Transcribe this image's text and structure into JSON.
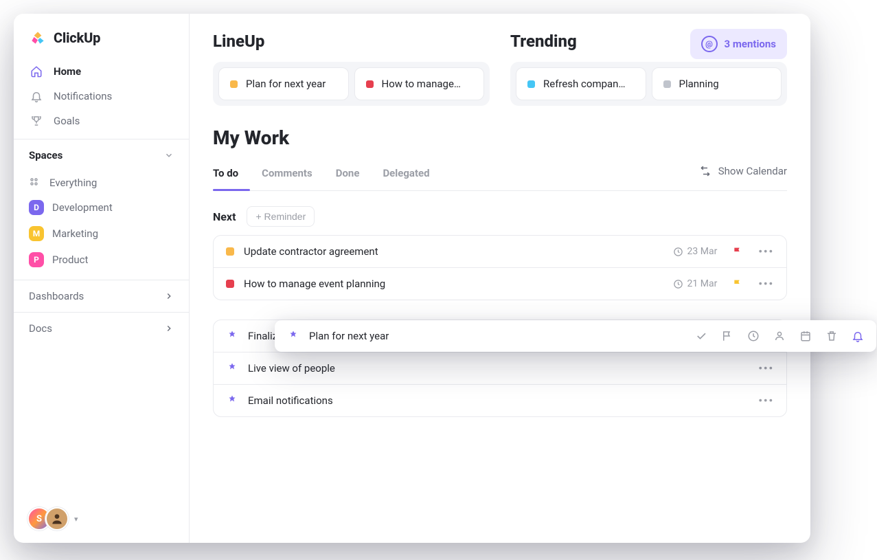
{
  "brand": {
    "name": "ClickUp"
  },
  "nav": {
    "home": {
      "label": "Home"
    },
    "notifications": {
      "label": "Notifications"
    },
    "goals": {
      "label": "Goals"
    }
  },
  "sidebar": {
    "spaces_header": "Spaces",
    "everything": "Everything",
    "spaces": [
      {
        "initial": "D",
        "label": "Development",
        "color": "#7b68ee"
      },
      {
        "initial": "M",
        "label": "Marketing",
        "color": "#f9c430"
      },
      {
        "initial": "P",
        "label": "Product",
        "color": "#ff4fa7"
      }
    ],
    "dashboards": "Dashboards",
    "docs": "Docs"
  },
  "user": {
    "initial": "S"
  },
  "lineup": {
    "title": "LineUp",
    "items": [
      {
        "color": "#f9b84a",
        "label": "Plan for next year"
      },
      {
        "color": "#e63f4e",
        "label": "How to manage…"
      }
    ]
  },
  "trending": {
    "title": "Trending",
    "items": [
      {
        "color": "#45c6f5",
        "label": "Refresh compan…"
      },
      {
        "color": "#c0c4cc",
        "label": "Planning"
      }
    ]
  },
  "mentions": {
    "label": "3 mentions"
  },
  "mywork": {
    "title": "My Work",
    "tabs": {
      "todo": "To do",
      "comments": "Comments",
      "done": "Done",
      "delegated": "Delegated"
    },
    "show_calendar": "Show Calendar",
    "next_label": "Next",
    "reminder_btn": "+ Reminder",
    "group1": [
      {
        "color": "#f9b84a",
        "title": "Update contractor agreement",
        "date": "23 Mar",
        "flag": "#e63f4e"
      },
      {
        "color": "#e63f4e",
        "title": "How to manage event planning",
        "date": "21 Mar",
        "flag": "#f9c430"
      }
    ],
    "group2": [
      {
        "title": "Finalize project scope"
      },
      {
        "title": "Live view of people"
      },
      {
        "title": "Email notifications"
      }
    ]
  },
  "floater": {
    "title": "Plan for next year"
  }
}
